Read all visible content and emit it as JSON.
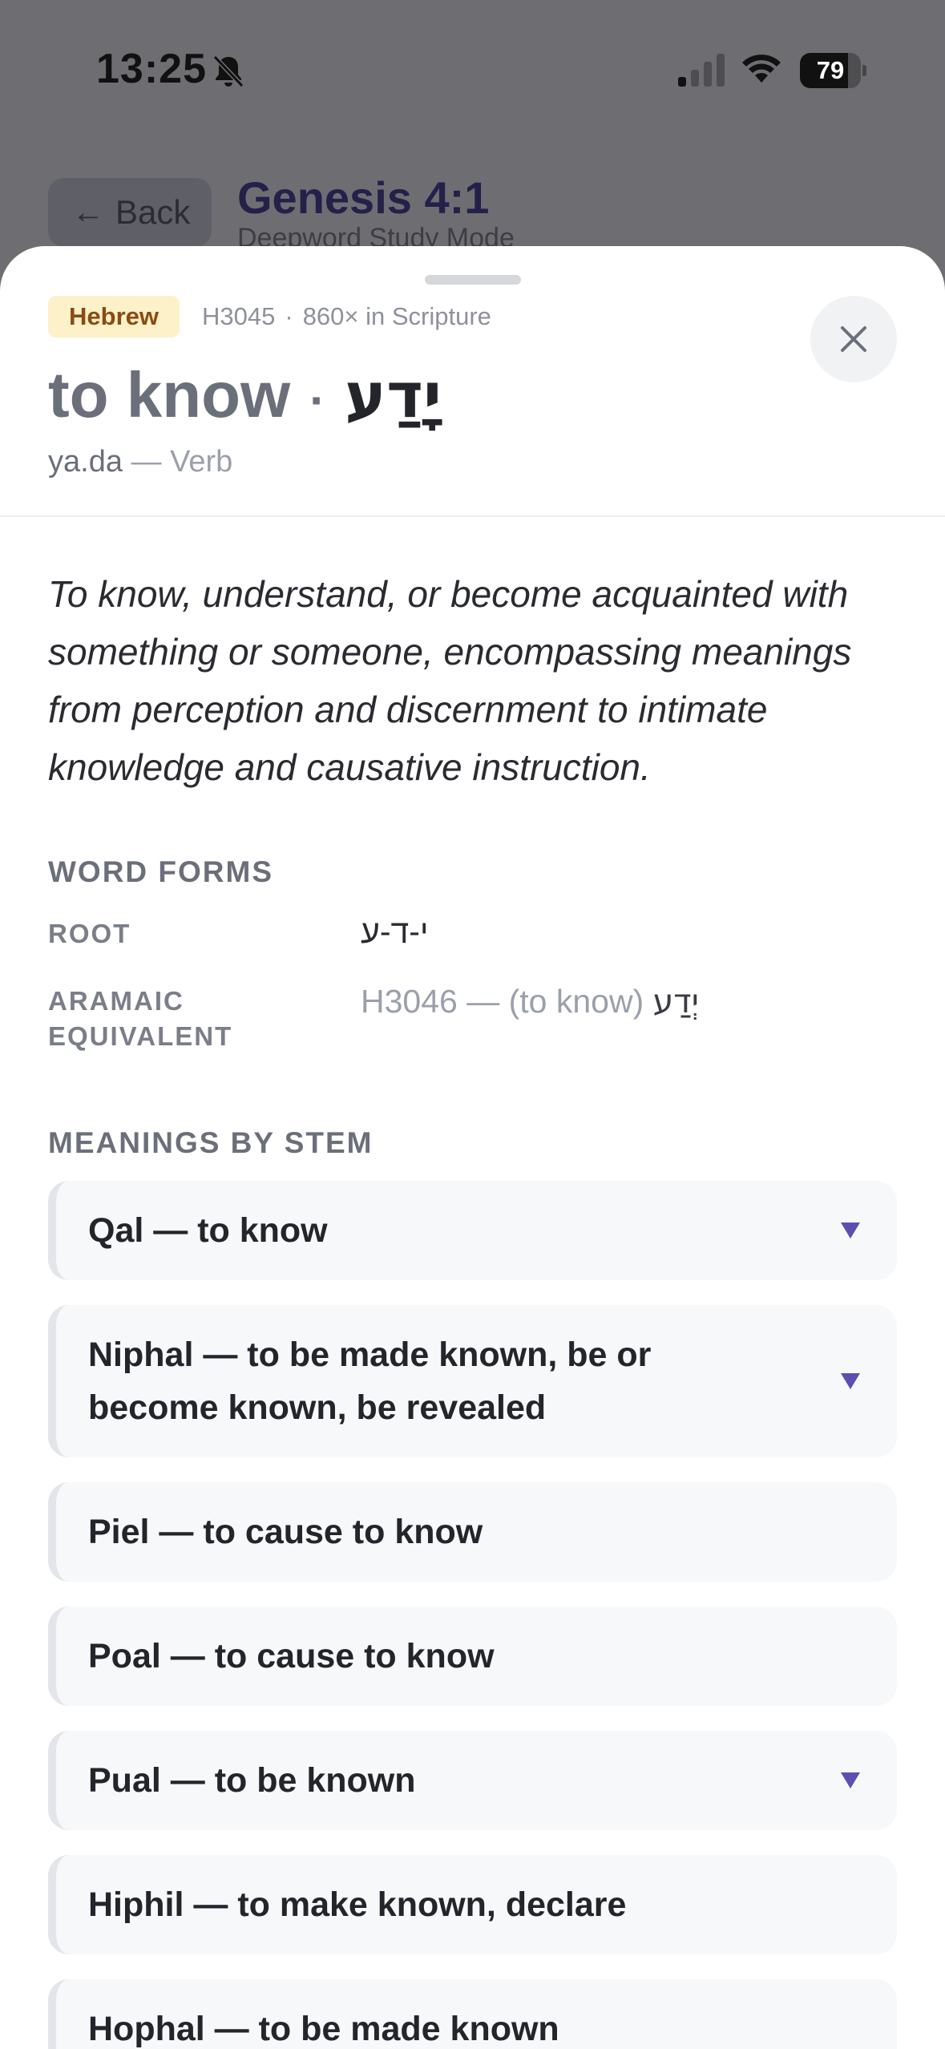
{
  "status_bar": {
    "time": "13:25",
    "battery": "79",
    "battery_level": 0.79
  },
  "background_page": {
    "back_label": "Back",
    "title": "Genesis 4:1",
    "subtitle": "Deepword Study Mode"
  },
  "entry": {
    "language": "Hebrew",
    "strongs": "H3045",
    "separator": "·",
    "occurrences": "860× in Scripture",
    "gloss": "to know",
    "headword_separator": "·",
    "hebrew": "יָדַע",
    "transliteration": "ya.da",
    "dash": "—",
    "part_of_speech": "Verb",
    "definition": "To know, understand, or become acquainted with something or someone, encompassing meanings from perception and discernment to intimate knowledge and causative instruction."
  },
  "word_forms": {
    "heading": "WORD FORMS",
    "root_label": "ROOT",
    "root_value": "י-ד-ע",
    "aramaic_label_line1": "ARAMAIC",
    "aramaic_label_line2": "EQUIVALENT",
    "aramaic_ref": "H3046 —",
    "aramaic_gloss": "(to know)",
    "aramaic_hebrew": "יְדַע"
  },
  "stems": {
    "heading": "MEANINGS BY STEM",
    "items": [
      {
        "label": "Qal — to know",
        "expandable": true
      },
      {
        "label": "Niphal — to be made known, be or become known, be revealed",
        "expandable": true
      },
      {
        "label": "Piel — to cause to know",
        "expandable": false
      },
      {
        "label": "Poal — to cause to know",
        "expandable": false
      },
      {
        "label": "Pual — to be known",
        "expandable": true
      },
      {
        "label": "Hiphil — to make known, declare",
        "expandable": false
      },
      {
        "label": "Hophal — to be made known",
        "expandable": false
      }
    ]
  },
  "colors": {
    "accent": "#5b4fb0",
    "badge_bg": "#fdf1c9",
    "badge_text": "#8a4b12"
  }
}
